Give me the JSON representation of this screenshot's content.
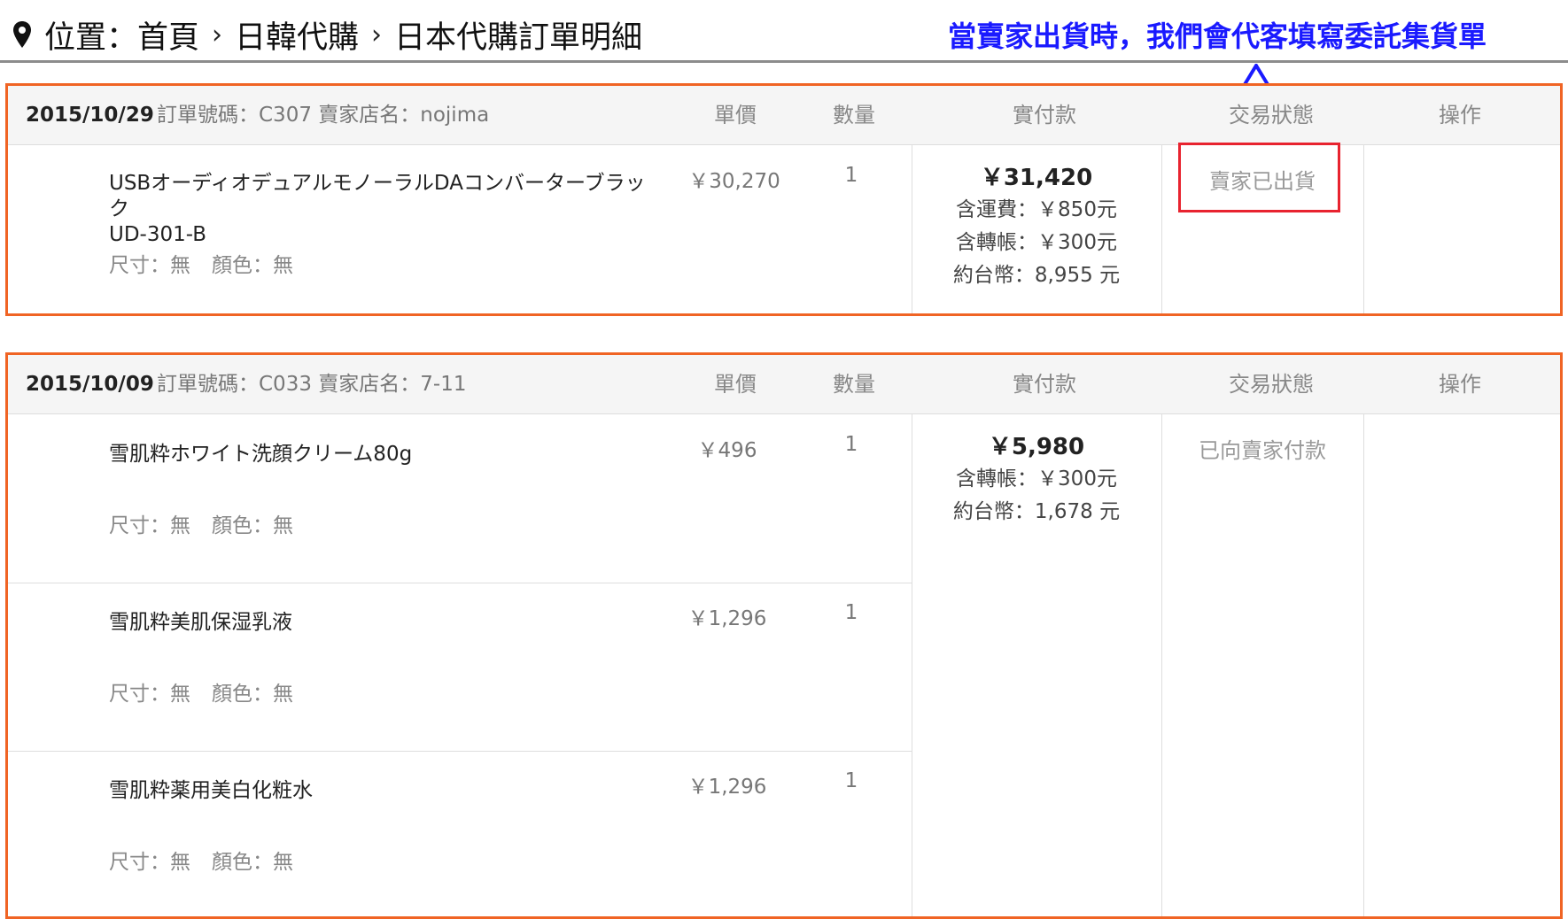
{
  "breadcrumb": {
    "prefix": "位置：首頁",
    "sep": "›",
    "level2": "日韓代購",
    "level3": "日本代購訂單明細"
  },
  "annotation": {
    "text": "當賣家出貨時，我們會代客填寫委託集貨單",
    "color": "#1a1aff"
  },
  "columns": {
    "unit_price": "單價",
    "quantity": "數量",
    "paid": "實付款",
    "status": "交易狀態",
    "actions": "操作"
  },
  "orders": [
    {
      "date": "2015/10/29",
      "meta": "訂單號碼：C307 賣家店名：nojima",
      "items": [
        {
          "name_line1": "USBオーディオデュアルモノーラルDAコンバーターブラック",
          "name_line2": "UD-301-B",
          "attrs_size": "尺寸：無",
          "attrs_color": "顏色：無",
          "price": "￥30,270",
          "qty": "1"
        }
      ],
      "payment": {
        "total": "￥31,420",
        "shipping": "含運費：￥850元",
        "transfer": "含轉帳：￥300元",
        "twd": "約台幣：8,955 元"
      },
      "status": "賣家已出貨"
    },
    {
      "date": "2015/10/09",
      "meta": "訂單號碼：C033 賣家店名：7-11",
      "items": [
        {
          "name": "雪肌粋ホワイト洗顔クリーム80g",
          "attrs_size": "尺寸：無",
          "attrs_color": "顏色：無",
          "price": "￥496",
          "qty": "1"
        },
        {
          "name": "雪肌粋美肌保湿乳液",
          "attrs_size": "尺寸：無",
          "attrs_color": "顏色：無",
          "price": "￥1,296",
          "qty": "1"
        },
        {
          "name": "雪肌粋薬用美白化粧水",
          "attrs_size": "尺寸：無",
          "attrs_color": "顏色：無",
          "price": "￥1,296",
          "qty": "1"
        }
      ],
      "payment": {
        "total": "￥5,980",
        "transfer": "含轉帳：￥300元",
        "twd": "約台幣：1,678 元"
      },
      "status": "已向賣家付款"
    }
  ],
  "colors": {
    "order_border": "#f06424",
    "status_highlight": "#e8232f"
  }
}
